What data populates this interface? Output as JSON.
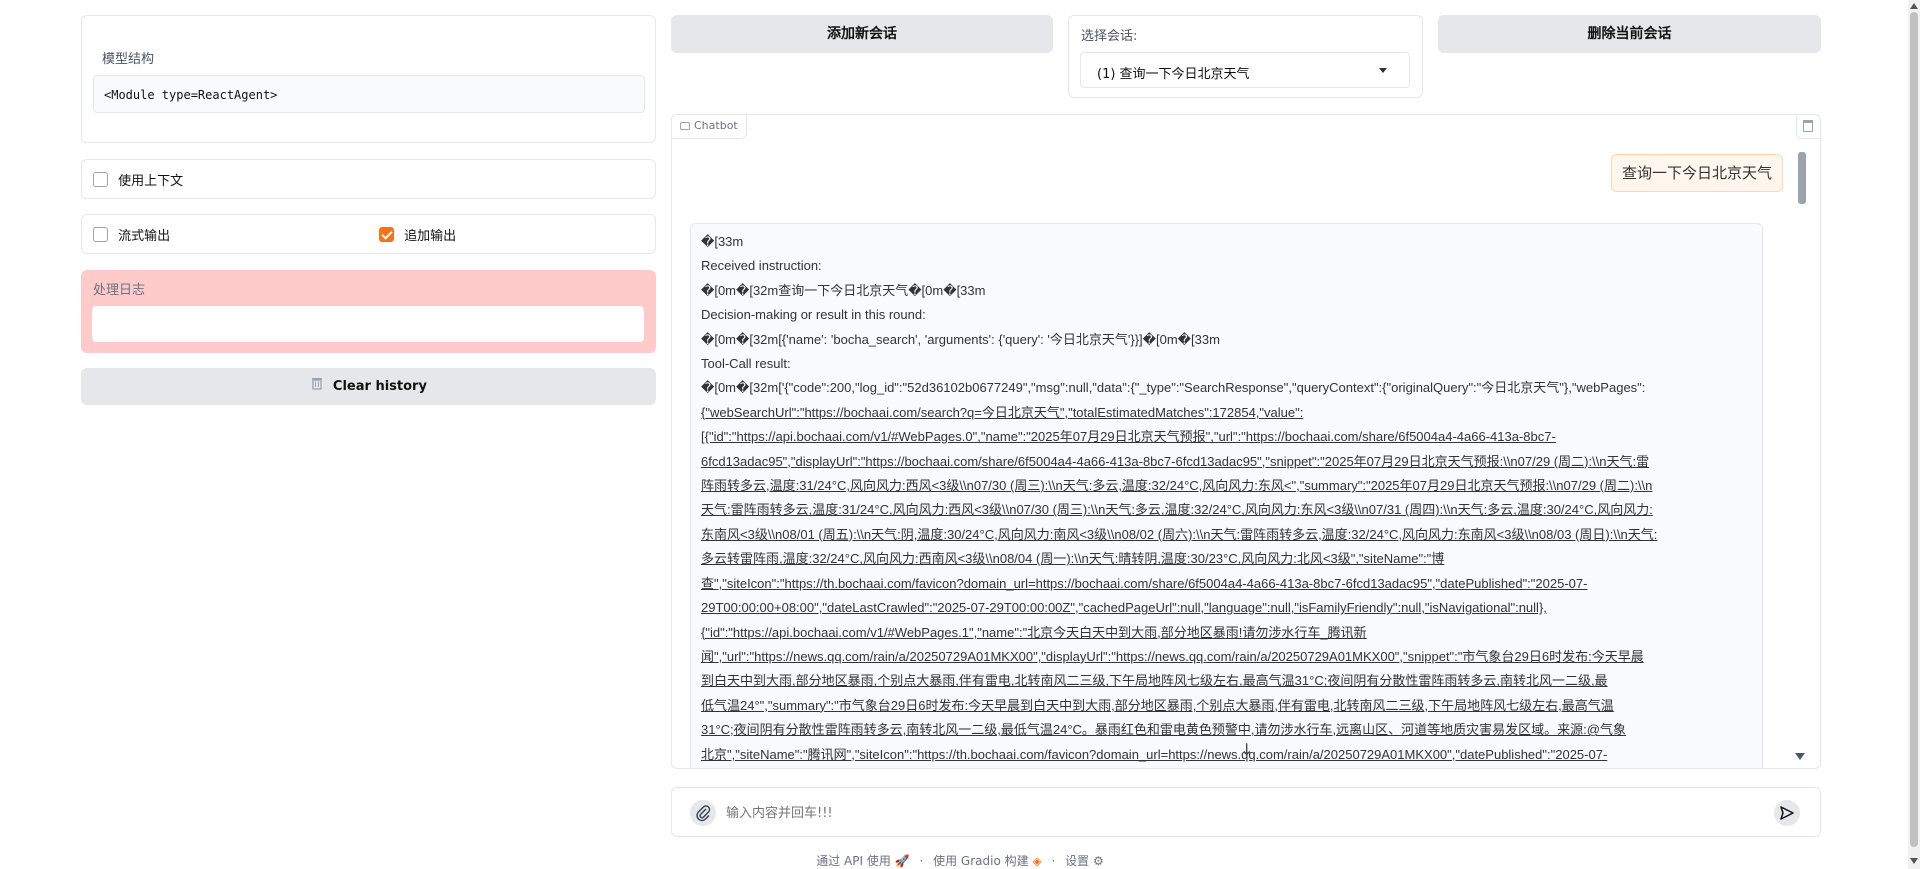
{
  "left": {
    "model_label": "模型结构",
    "model_value": "<Module type=ReactAgent>",
    "use_context_label": "使用上下文",
    "stream_label": "流式输出",
    "append_label": "追加输出",
    "log_label": "处理日志",
    "log_value": "",
    "clear_label": "Clear history",
    "use_context_checked": false,
    "stream_checked": false,
    "append_checked": true
  },
  "top": {
    "add_session": "添加新会话",
    "select_label": "选择会话:",
    "selected": "(1) 查询一下今日北京天气",
    "delete_session": "删除当前会话"
  },
  "chat": {
    "title": "Chatbot",
    "user_message": "查询一下今日北京天气",
    "input_placeholder": "输入内容并回车!!!",
    "bot_lines": [
      "�[33m",
      "Received instruction:",
      "�[0m�[32m查询一下今日北京天气�[0m�[33m",
      "Decision-making or result in this round:",
      "�[0m�[32m[{'name': 'bocha_search', 'arguments': {'query': '今日北京天气'}}]�[0m�[33m",
      "Tool-Call result:",
      "�[0m�[32m['{\"code\":200,\"log_id\":\"52d36102b0677249\",\"msg\":null,\"data\":{\"_type\":\"SearchResponse\",\"queryContext\":{\"originalQuery\":\"今日北京天气\"},\"webPages\":",
      "{\"webSearchUrl\":\"https://bochaai.com/search?q=今日北京天气\",\"totalEstimatedMatches\":172854,\"value\":",
      "[{\"id\":\"https://api.bochaai.com/v1/#WebPages.0\",\"name\":\"2025年07月29日北京天气预报\",\"url\":\"https://bochaai.com/share/6f5004a4-4a66-413a-8bc7-",
      "6fcd13adac95\",\"displayUrl\":\"https://bochaai.com/share/6f5004a4-4a66-413a-8bc7-6fcd13adac95\",\"snippet\":\"2025年07月29日北京天气预报:\\\\n07/29 (周二):\\\\n天气:雷",
      "阵雨转多云,温度:31/24°C,风向风力:西风<3级\\\\n07/30 (周三):\\\\n天气:多云,温度:32/24°C,风向风力:东风<\",\"summary\":\"2025年07月29日北京天气预报:\\\\n07/29 (周二):\\\\n",
      "天气:雷阵雨转多云,温度:31/24°C,风向风力:西风<3级\\\\n07/30 (周三):\\\\n天气:多云,温度:32/24°C,风向风力:东风<3级\\\\n07/31 (周四):\\\\n天气:多云,温度:30/24°C,风向风力:",
      "东南风<3级\\\\n08/01 (周五):\\\\n天气:阴,温度:30/24°C,风向风力:南风<3级\\\\n08/02 (周六):\\\\n天气:雷阵雨转多云,温度:32/24°C,风向风力:东南风<3级\\\\n08/03 (周日):\\\\n天气:",
      "多云转雷阵雨,温度:32/24°C,风向风力:西南风<3级\\\\n08/04 (周一):\\\\n天气:晴转阴,温度:30/23°C,风向风力:北风<3级\",\"siteName\":\"博",
      "查\",\"siteIcon\":\"https://th.bochaai.com/favicon?domain_url=https://bochaai.com/share/6f5004a4-4a66-413a-8bc7-6fcd13adac95\",\"datePublished\":\"2025-07-",
      "29T00:00:00+08:00\",\"dateLastCrawled\":\"2025-07-29T00:00:00Z\",\"cachedPageUrl\":null,\"language\":null,\"isFamilyFriendly\":null,\"isNavigational\":null},",
      "{\"id\":\"https://api.bochaai.com/v1/#WebPages.1\",\"name\":\"北京今天白天中到大雨,部分地区暴雨!请勿涉水行车_腾讯新",
      "闻\",\"url\":\"https://news.qq.com/rain/a/20250729A01MKX00\",\"displayUrl\":\"https://news.qq.com/rain/a/20250729A01MKX00\",\"snippet\":\"市气象台29日6时发布:今天早晨",
      "到白天中到大雨,部分地区暴雨,个别点大暴雨,伴有雷电,北转南风二三级,下午局地阵风七级左右,最高气温31°C;夜间阴有分散性雷阵雨转多云,南转北风一二级,最",
      "低气温24°\",\"summary\":\"市气象台29日6时发布:今天早晨到白天中到大雨,部分地区暴雨,个别点大暴雨,伴有雷电,北转南风二三级,下午局地阵风七级左右,最高气温",
      "31°C;夜间阴有分散性雷阵雨转多云,南转北风一二级,最低气温24°C。暴雨红色和雷电黄色预警中,请勿涉水行车,远离山区、河道等地质灾害易发区域。来源:@气象",
      "北京\",\"siteName\":\"腾讯网\",\"siteIcon\":\"https://th.bochaai.com/favicon?domain_url=https://news.qq.com/rain/a/20250729A01MKX00\",\"datePublished\":\"2025-07-"
    ]
  },
  "footer": {
    "api": "通过 API 使用",
    "sep1": "·",
    "gradio": "使用 Gradio 构建",
    "sep2": "·",
    "settings": "设置"
  }
}
